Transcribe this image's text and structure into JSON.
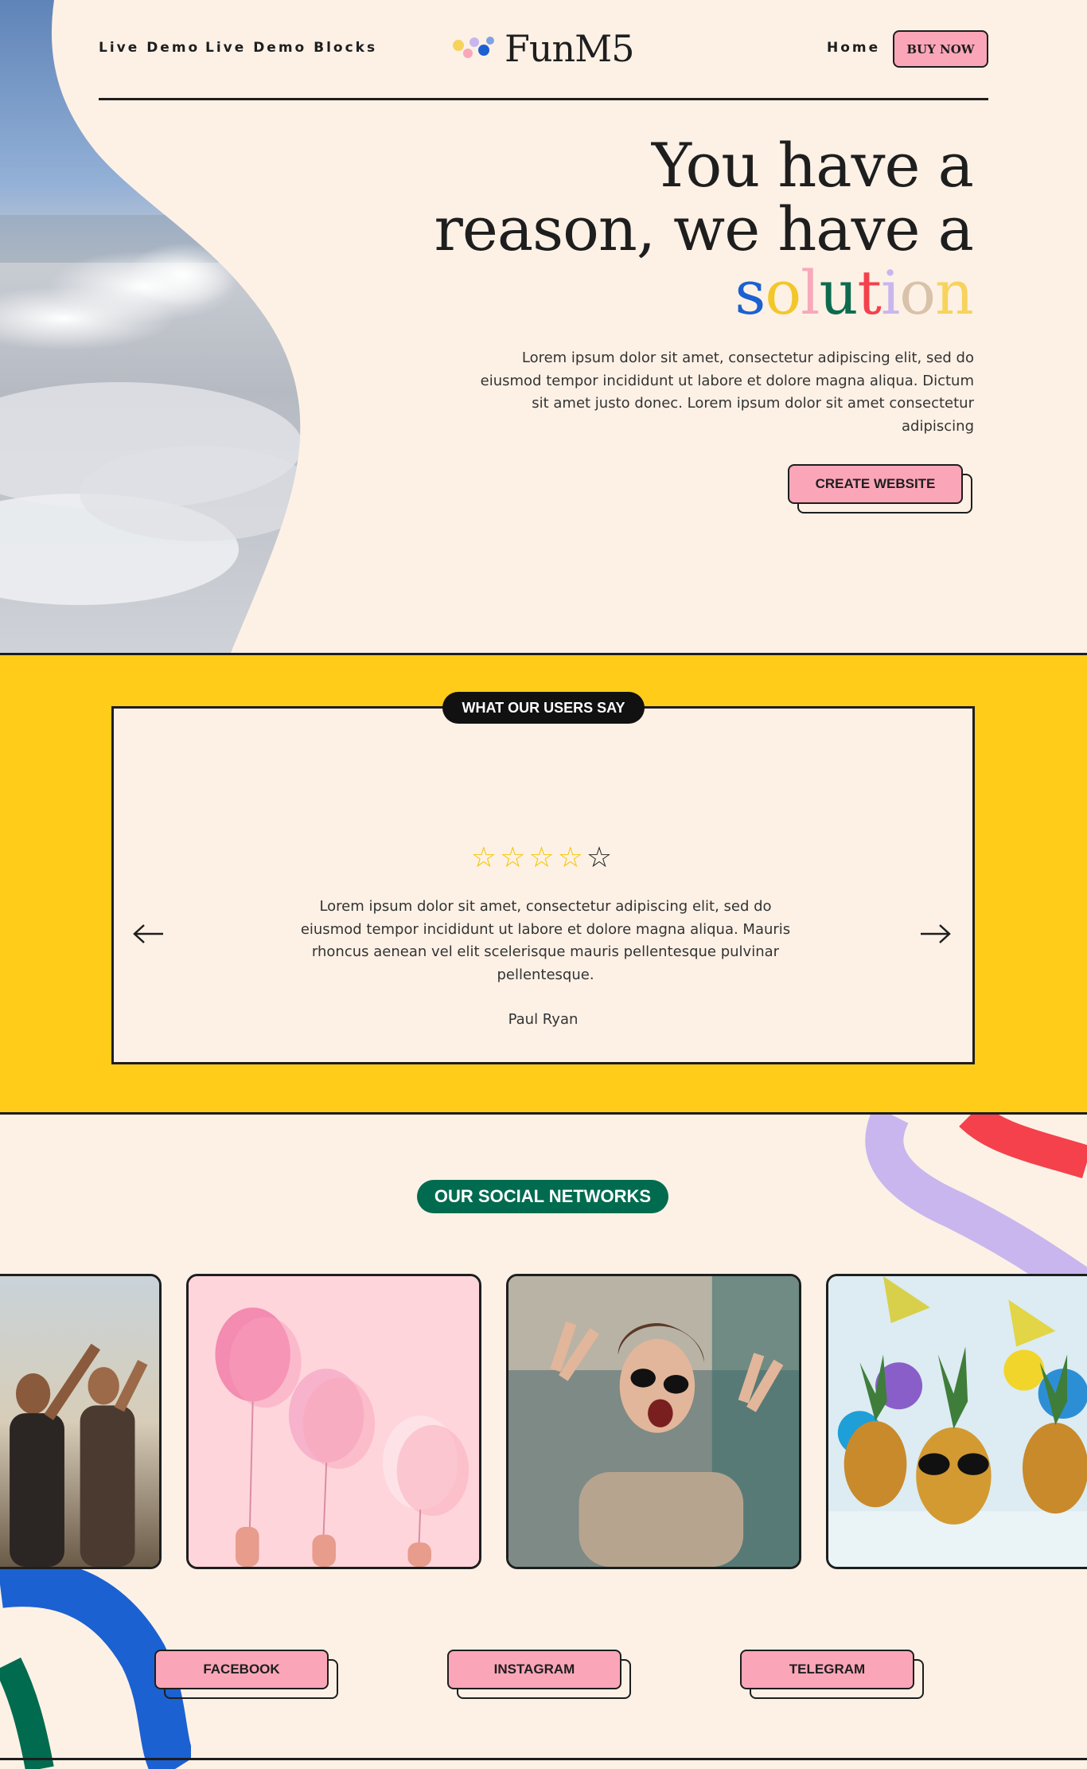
{
  "nav": {
    "links": [
      "Live Demo",
      "Live Demo Blocks"
    ],
    "logo_text": "FunM5",
    "home_label": "Home",
    "buy_label": "BUY NOW"
  },
  "hero": {
    "title_line1": "You have a",
    "title_line2": "reason, we have a",
    "solution_letters": [
      "s",
      "o",
      "l",
      "u",
      "t",
      "i",
      "o",
      "n"
    ],
    "solution_colors": [
      "#1b61d1",
      "#f2c72a",
      "#f7a9ba",
      "#0d6b4f",
      "#f4414c",
      "#c9b6ee",
      "#d9c2aa",
      "#f7d35d"
    ],
    "description": "Lorem ipsum dolor sit amet, consectetur adipiscing elit, sed do eiusmod tempor incididunt ut labore et dolore magna aliqua. Dictum sit amet justo donec. Lorem ipsum dolor sit amet consectetur adipiscing",
    "cta_label": "CREATE WEBSITE"
  },
  "testimonials": {
    "badge": "WHAT OUR USERS SAY",
    "rating": 4,
    "max_rating": 5,
    "quote": "Lorem ipsum dolor sit amet, consectetur adipiscing elit, sed do eiusmod tempor incididunt ut labore et dolore magna aliqua. Mauris rhoncus aenean vel elit scelerisque mauris pellentesque pulvinar pellentesque.",
    "author": "Paul Ryan",
    "prev_icon": "arrow-left-icon",
    "next_icon": "arrow-right-icon"
  },
  "social": {
    "badge": "OUR SOCIAL NETWORKS",
    "buttons": [
      "FACEBOOK",
      "INSTAGRAM",
      "TELEGRAM"
    ]
  },
  "colors": {
    "background": "#fdf1e6",
    "yellow": "#ffcc1a",
    "pink": "#fba6b8",
    "green": "#006b4f",
    "blue": "#1b61d1",
    "lavender": "#c9b6ee",
    "red": "#f4414c",
    "star": "#f5c400"
  }
}
